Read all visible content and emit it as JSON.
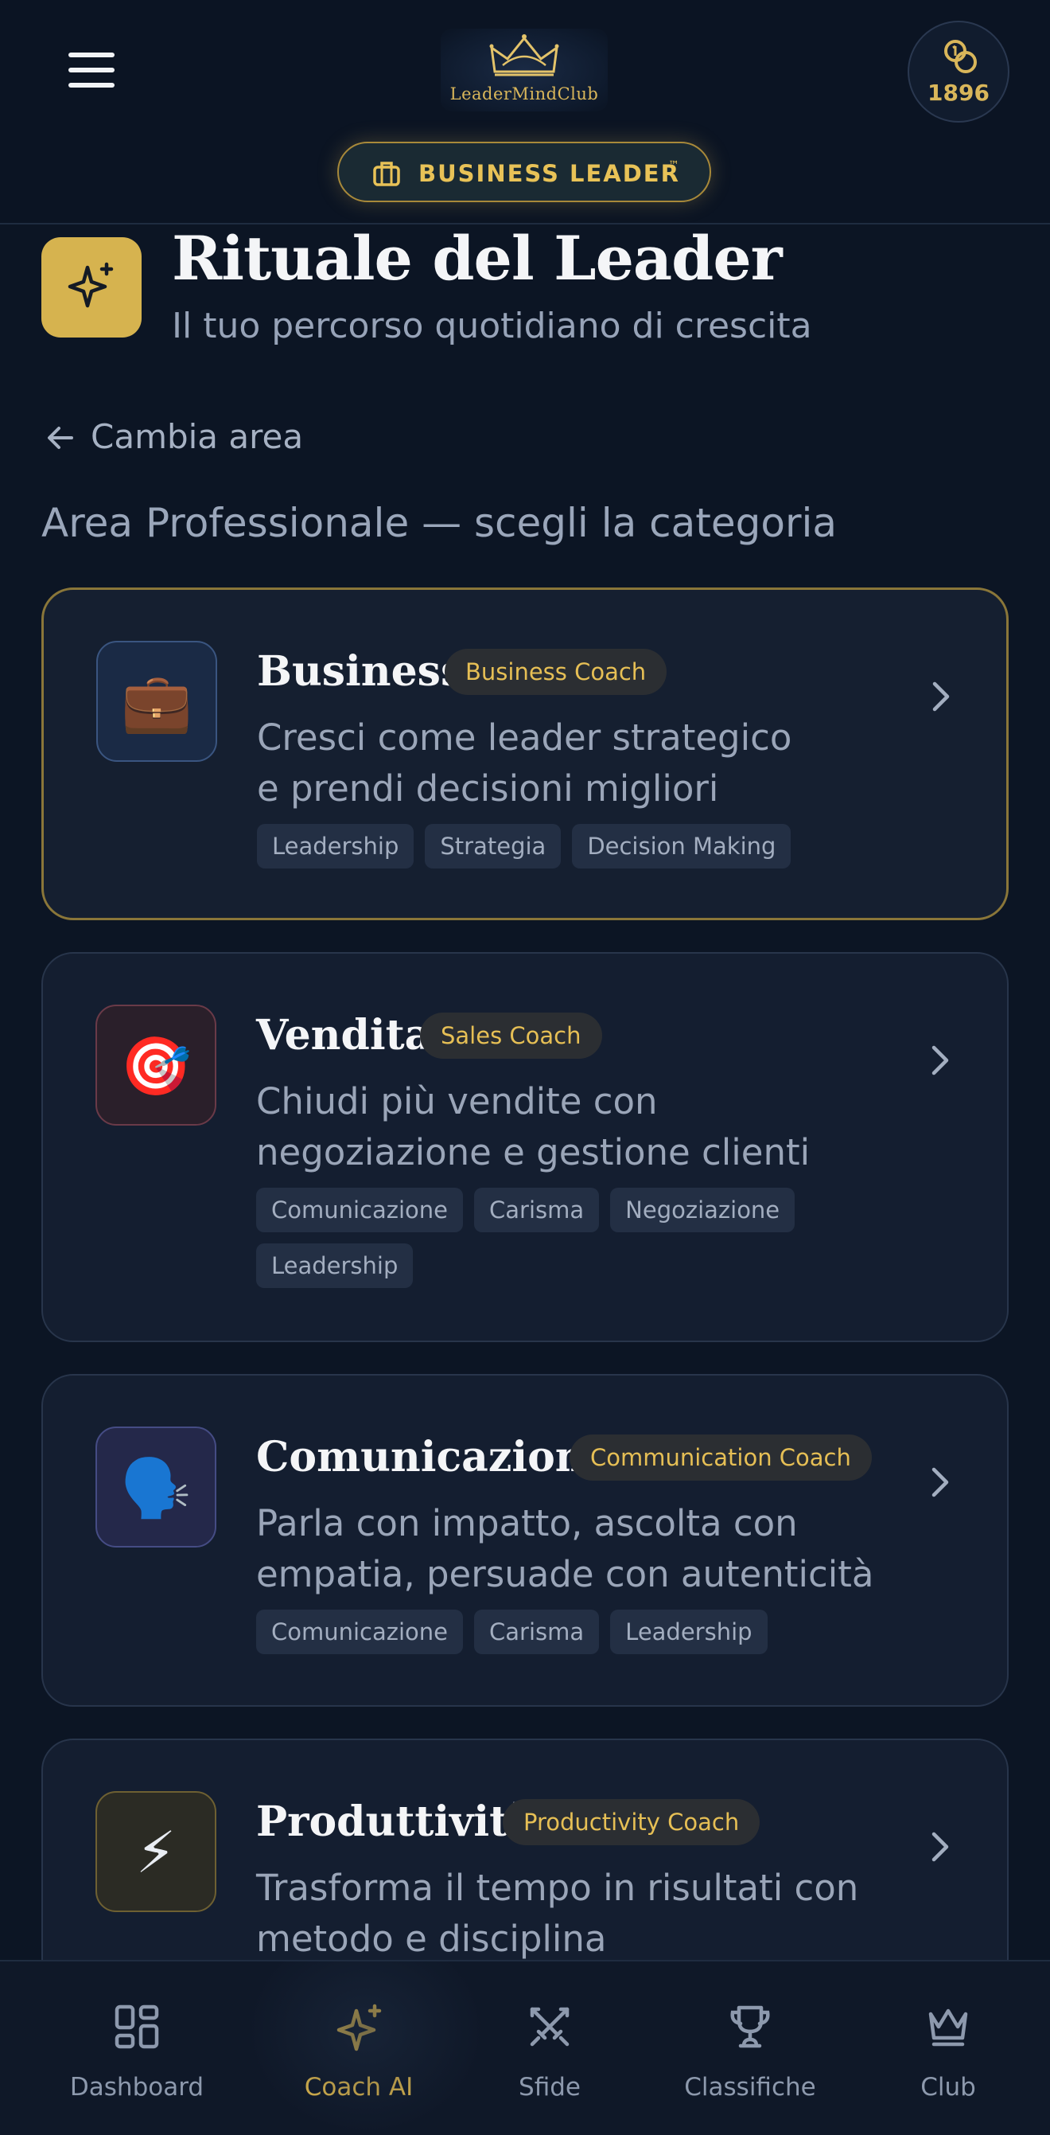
{
  "header": {
    "logo_text": "LeaderMindClub",
    "coins": "1896",
    "status_label": "BUSINESS LEADER",
    "status_tm": "™"
  },
  "page": {
    "title": "Rituale del Leader",
    "subtitle": "Il tuo percorso quotidiano di crescita",
    "back_label": "Cambia area",
    "section_label": "Area Professionale — scegli la categoria"
  },
  "categories": [
    {
      "title": "Business",
      "badge": "Business Coach",
      "icon": "briefcase-icon",
      "emoji": "💼",
      "desc": "Cresci come leader strategico e prendi decisioni migliori",
      "tags": [
        "Leadership",
        "Strategia",
        "Decision Making"
      ]
    },
    {
      "title": "Vendita",
      "badge": "Sales Coach",
      "icon": "target-icon",
      "emoji": "🎯",
      "desc": "Chiudi più vendite con negoziazione e gestione clienti",
      "tags": [
        "Comunicazione",
        "Carisma",
        "Negoziazione",
        "Leadership"
      ]
    },
    {
      "title": "Comunicazione",
      "badge": "Communication Coach",
      "icon": "speaking-head-icon",
      "emoji": "🗣️",
      "desc": "Parla con impatto, ascolta con empatia, persuade con autenticità",
      "tags": [
        "Comunicazione",
        "Carisma",
        "Leadership"
      ]
    },
    {
      "title": "Produttività",
      "badge": "Productivity Coach",
      "icon": "lightning-icon",
      "emoji": "⚡",
      "desc": "Trasforma il tempo in risultati con metodo e disciplina",
      "tags": []
    }
  ],
  "nav": {
    "items": [
      {
        "label": "Dashboard",
        "icon": "dashboard-grid-icon"
      },
      {
        "label": "Coach AI",
        "icon": "sparkles-icon"
      },
      {
        "label": "Sfide",
        "icon": "crossed-swords-icon"
      },
      {
        "label": "Classifiche",
        "icon": "trophy-icon"
      },
      {
        "label": "Club",
        "icon": "crown-icon"
      }
    ],
    "active": "Coach AI"
  },
  "colors": {
    "background": "#0c1524",
    "card": "#141e30",
    "accent_gold": "#d6b34f",
    "text_muted": "#9aa5b8"
  }
}
